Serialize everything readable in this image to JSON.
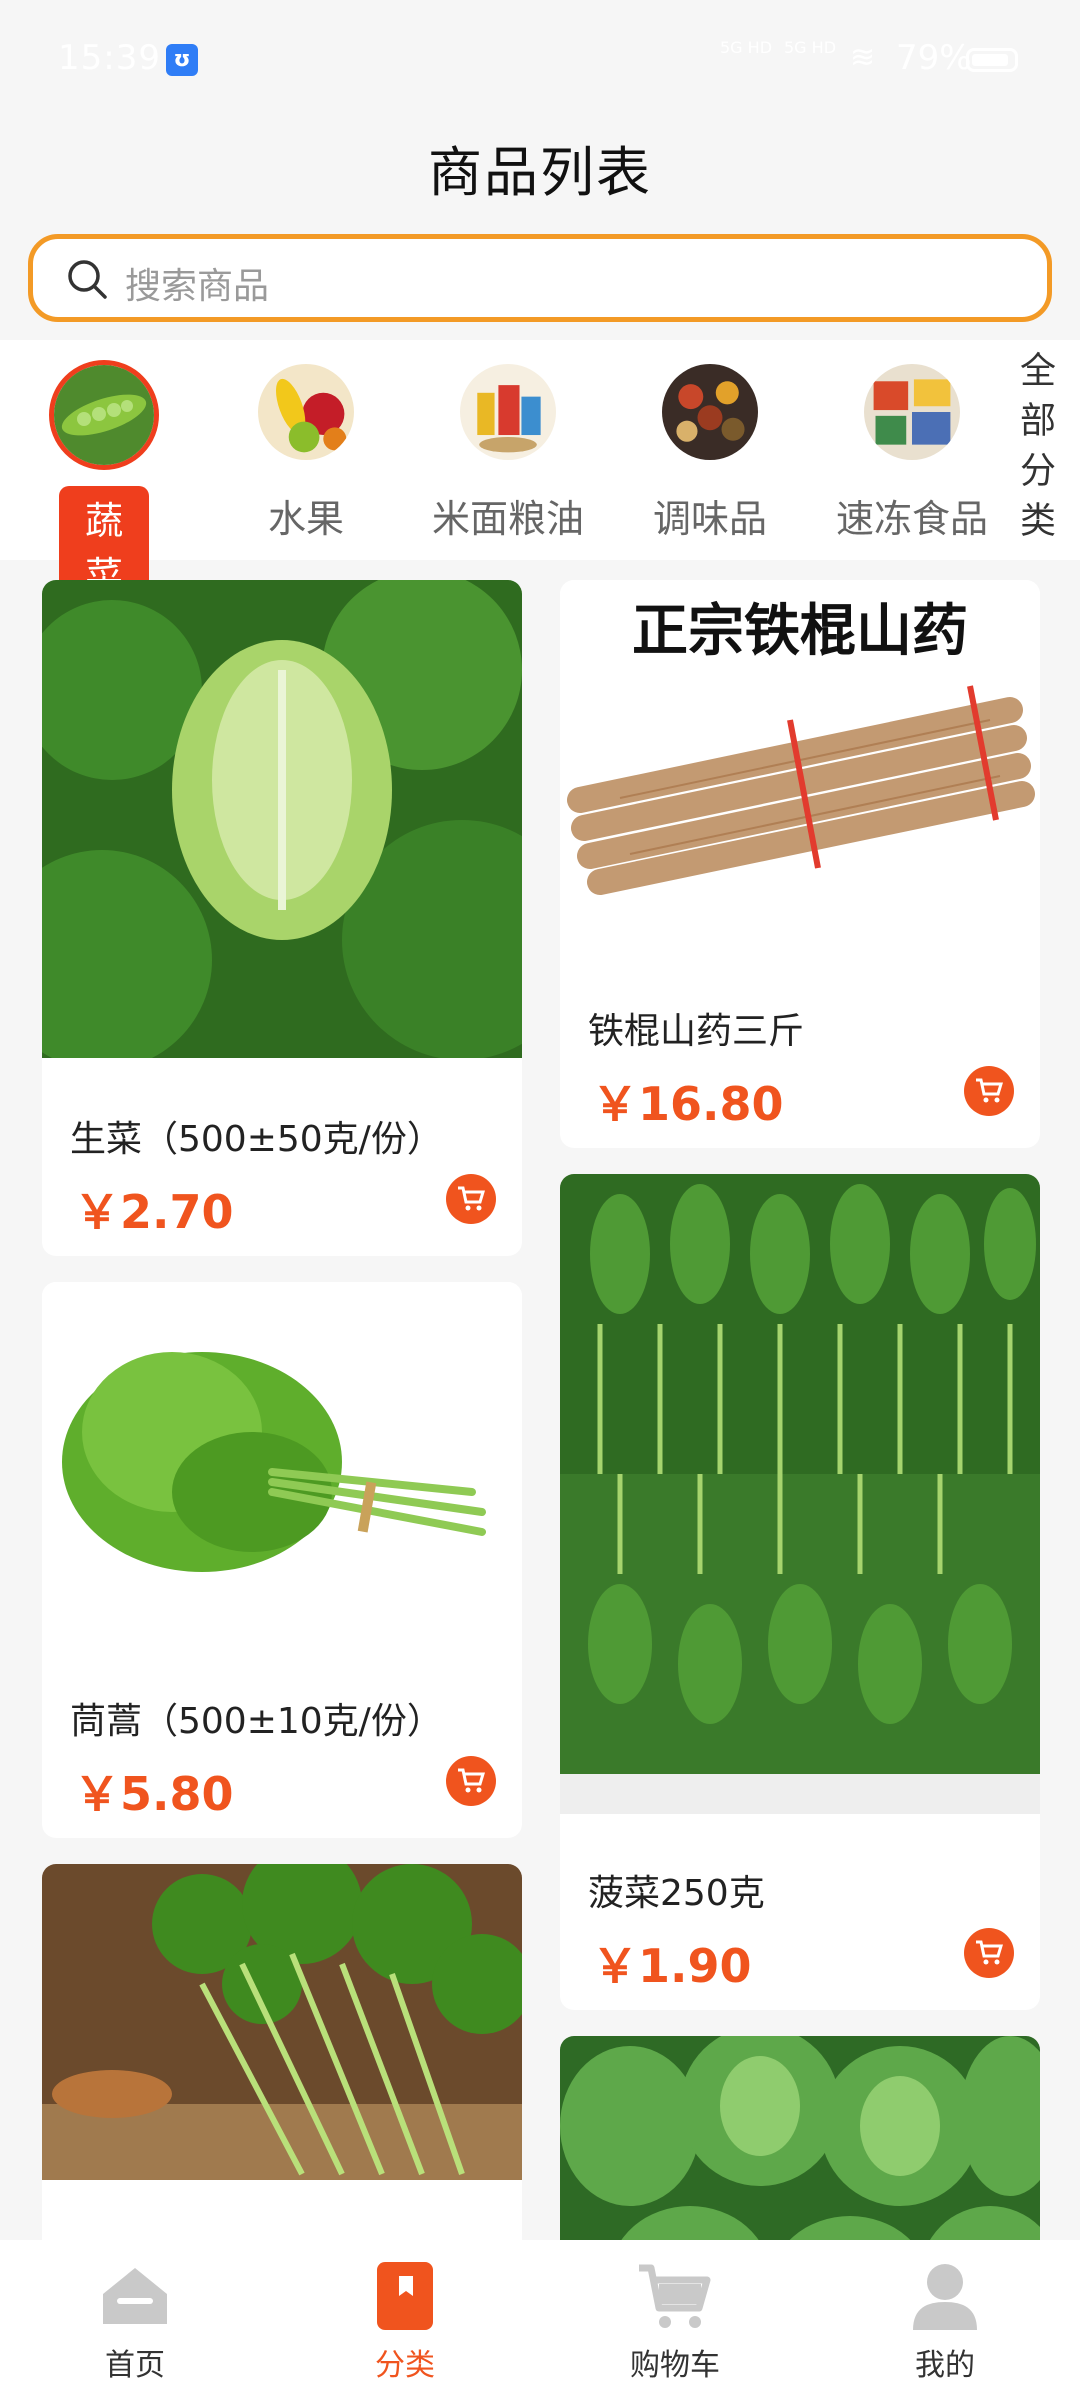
{
  "status_bar": {
    "time": "15:39",
    "signal_1": "5G HD",
    "signal_2": "5G HD",
    "battery": "79%"
  },
  "page": {
    "title": "商品列表"
  },
  "search": {
    "placeholder": "搜索商品"
  },
  "categories": [
    {
      "label": "蔬菜",
      "active": true
    },
    {
      "label": "水果",
      "active": false
    },
    {
      "label": "米面粮油",
      "active": false
    },
    {
      "label": "调味品",
      "active": false
    },
    {
      "label": "速冻食品",
      "active": false
    }
  ],
  "all_categories_label": "全部分类",
  "products": [
    {
      "name": "生菜（500±50克/份）",
      "price": "￥2.70"
    },
    {
      "name": "铁棍山药三斤",
      "price": "￥16.80",
      "image_caption": "正宗铁棍山药"
    },
    {
      "name": "茼蒿（500±10克/份）",
      "price": "￥5.80"
    },
    {
      "name": "菠菜250克",
      "price": "￥1.90"
    },
    {
      "name": "",
      "price": ""
    },
    {
      "name": "",
      "price": ""
    }
  ],
  "tabs": [
    {
      "label": "首页",
      "icon": "home-icon",
      "active": false
    },
    {
      "label": "分类",
      "icon": "category-icon",
      "active": true
    },
    {
      "label": "购物车",
      "icon": "cart-icon",
      "active": false
    },
    {
      "label": "我的",
      "icon": "user-icon",
      "active": false
    }
  ],
  "colors": {
    "accent": "#f0541e",
    "search_border": "#f39a26",
    "active_category": "#ef3e1d"
  }
}
